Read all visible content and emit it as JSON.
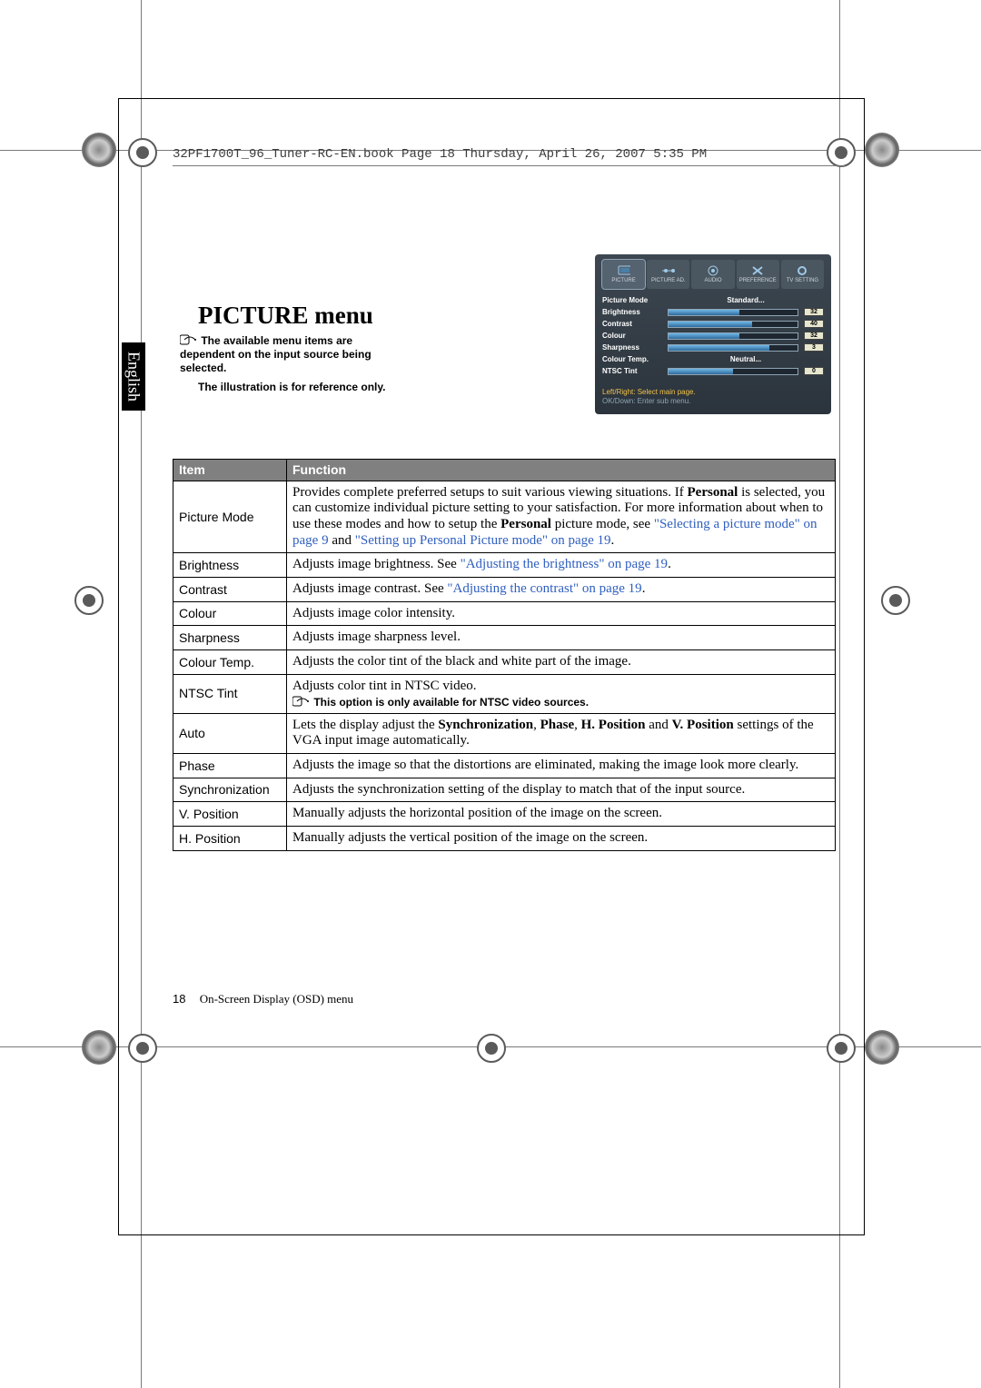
{
  "doc_header": "32PF1700T_96_Tuner-RC-EN.book  Page 18  Thursday, April 26, 2007  5:35 PM",
  "side_tab": "English",
  "title": "PICTURE menu",
  "note1": "The available menu items are dependent on the input source being selected.",
  "note2": "The illustration is for reference only.",
  "osd": {
    "tabs": [
      "PICTURE",
      "PICTURE AD.",
      "AUDIO",
      "PREFERENCE",
      "TV SETTING"
    ],
    "rows": {
      "picture_mode": {
        "label": "Picture Mode",
        "value": "Standard..."
      },
      "brightness": {
        "label": "Brightness",
        "value": "32",
        "fill": 55
      },
      "contrast": {
        "label": "Contrast",
        "value": "40",
        "fill": 65
      },
      "colour": {
        "label": "Colour",
        "value": "32",
        "fill": 55
      },
      "sharpness": {
        "label": "Sharpness",
        "value": "3",
        "fill": 78
      },
      "colour_temp": {
        "label": "Colour Temp.",
        "value": "Neutral..."
      },
      "ntsc_tint": {
        "label": "NTSC Tint",
        "value": "0",
        "fill": 50
      }
    },
    "hint1": "Left/Right: Select main page.",
    "hint2": "OK/Down: Enter sub menu."
  },
  "table": {
    "head_item": "Item",
    "head_func": "Function",
    "rows": [
      {
        "item": "Picture Mode",
        "body": "Provides complete preferred setups to suit various viewing situations. If <b>Personal</b> is selected, you can customize individual picture setting to your satisfaction. For more information about when to use these modes and how to setup the <b>Personal</b> picture mode, see <span class='link'>\"Selecting a picture mode\" on page 9</span> and <span class='link'>\"Setting up Personal Picture mode\" on page 19</span>."
      },
      {
        "item": "Brightness",
        "body": "Adjusts image brightness.  See <span class='link'>\"Adjusting the brightness\" on page 19</span>."
      },
      {
        "item": "Contrast",
        "body": "Adjusts image contrast. See <span class='link'>\"Adjusting the contrast\" on page 19</span>."
      },
      {
        "item": "Colour",
        "body": "Adjusts image color intensity."
      },
      {
        "item": "Sharpness",
        "body": "Adjusts image sharpness level."
      },
      {
        "item": "Colour Temp.",
        "body": "Adjusts the color tint of the black and white part of the image."
      },
      {
        "item": "NTSC Tint",
        "body": "Adjusts color tint in NTSC video.",
        "note": "This option is only available for NTSC video sources."
      },
      {
        "item": "Auto",
        "body": "Lets the display adjust the <b>Synchronization</b>, <b>Phase</b>, <b>H. Position</b> and <b>V. Position</b> settings of the VGA input image automatically."
      },
      {
        "item": "Phase",
        "body": "Adjusts the image so that the distortions are eliminated, making the image look more clearly."
      },
      {
        "item": "Synchronization",
        "body": "Adjusts the synchronization setting of the display to match that of the input source."
      },
      {
        "item": "V. Position",
        "body": "Manually adjusts the horizontal position of the image on the screen."
      },
      {
        "item": "H. Position",
        "body": "Manually adjusts the vertical position of the image on the screen."
      }
    ]
  },
  "footer": {
    "page": "18",
    "section": "On-Screen Display (OSD) menu"
  }
}
